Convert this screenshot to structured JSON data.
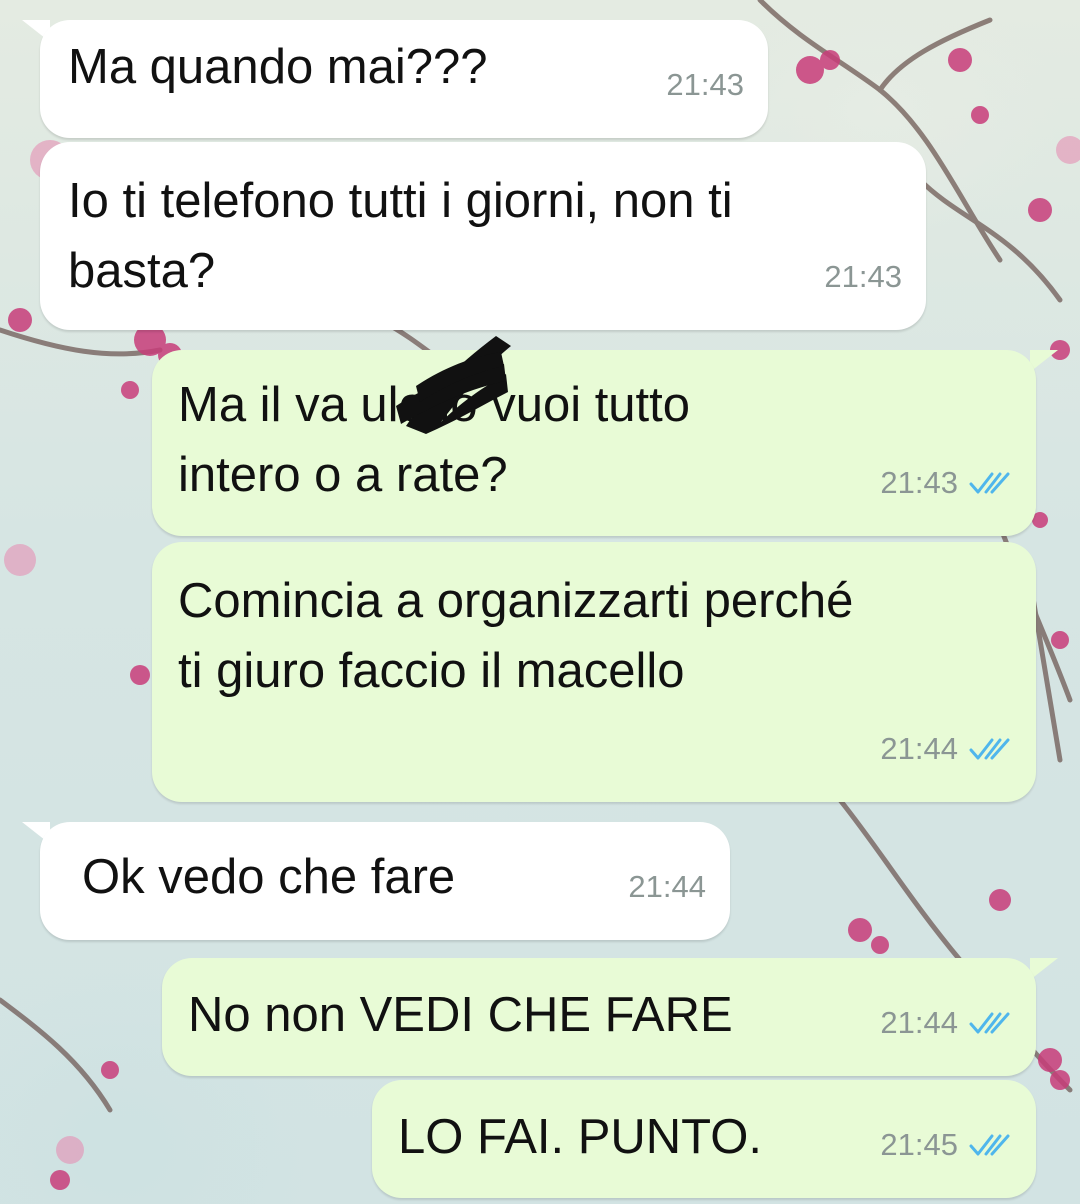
{
  "colors": {
    "incoming_bubble": "#ffffff",
    "outgoing_bubble": "#e8fbd6",
    "timestamp": "#8b9694",
    "read_ticks": "#4fb6ec"
  },
  "messages": [
    {
      "direction": "incoming",
      "text": "Ma quando mai???",
      "time": "21:43"
    },
    {
      "direction": "incoming",
      "text": "Io ti telefono tutti i giorni, non ti\nbasta?",
      "time": "21:43"
    },
    {
      "direction": "outgoing",
      "text": "Ma il va      ulo lo vuoi tutto\nintero o a rate?",
      "time": "21:43",
      "status_icon": "double-check-read-icon",
      "redacted": true
    },
    {
      "direction": "outgoing",
      "text": "Comincia a organizzarti perché\nti giuro faccio il macello",
      "time": "21:44",
      "status_icon": "double-check-read-icon"
    },
    {
      "direction": "incoming",
      "text": "Ok vedo che fare",
      "time": "21:44"
    },
    {
      "direction": "outgoing",
      "text": "No non VEDI CHE FARE",
      "time": "21:44",
      "status_icon": "double-check-read-icon"
    },
    {
      "direction": "outgoing",
      "text": "LO FAI. PUNTO.",
      "time": "21:45",
      "status_icon": "double-check-read-icon"
    }
  ]
}
